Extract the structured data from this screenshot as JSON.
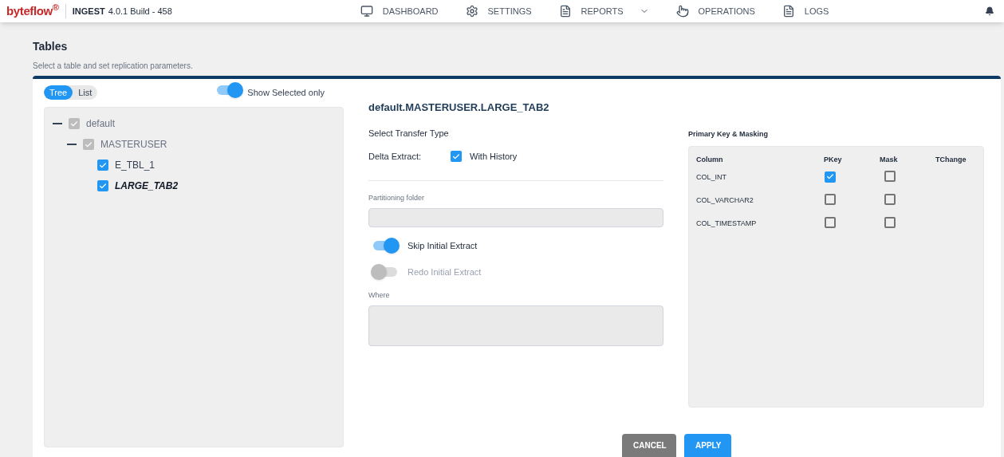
{
  "header": {
    "logo": "byteflow$^{®}$",
    "product": "INGEST",
    "version": "4.0.1 Build - 458",
    "nav": [
      {
        "label": "DASHBOARD",
        "dropdown": false
      },
      {
        "label": "SETTINGS",
        "dropdown": false
      },
      {
        "label": "REPORTS",
        "dropdown": true
      },
      {
        "label": "OPERATIONS",
        "dropdown": false
      },
      {
        "label": "LOGS",
        "dropdown": false
      }
    ]
  },
  "page": {
    "title": "Tables",
    "subtitle": "Select a table and set replication parameters."
  },
  "view_tabs": [
    {
      "label": "Tree",
      "selected": true
    },
    {
      "label": "List",
      "selected": false
    }
  ],
  "show_selected": {
    "label": "Show Selected only",
    "on": true
  },
  "tree": [
    {
      "label": "default",
      "checked": true,
      "disabled": true,
      "expanded": true,
      "selected": false,
      "children": [
        {
          "label": "MASTERUSER",
          "checked": true,
          "disabled": true,
          "expanded": true,
          "selected": false,
          "children": [
            {
              "label": "E_TBL_1",
              "checked": true,
              "disabled": false,
              "selected": false
            },
            {
              "label": "LARGE_TAB2",
              "checked": true,
              "disabled": false,
              "selected": true
            }
          ]
        }
      ]
    }
  ],
  "detail": {
    "title": "default.MASTERUSER.LARGE_TAB2",
    "transfer_type_label": "Select Transfer Type",
    "delta_label": "Delta Extract:",
    "with_history": {
      "label": "With History",
      "checked": true
    },
    "partition_folder": {
      "label": "Partitioning folder"
    },
    "switches": [
      {
        "label": "Skip Initial Extract",
        "on": true,
        "disabled": false
      },
      {
        "label": "Redo Initial Extract",
        "on": false,
        "disabled": true
      }
    ],
    "where": {
      "label": "Where"
    }
  },
  "pk_masking": {
    "title": "Primary Key & Masking",
    "columns": [
      "Column",
      "PKey",
      "Mask",
      "TChange"
    ],
    "rows": [
      {
        "name": "COL_INT",
        "pkey": true,
        "mask": false
      },
      {
        "name": "COL_VARCHAR2",
        "pkey": false,
        "mask": false
      },
      {
        "name": "COL_TIMESTAMP",
        "pkey": false,
        "mask": false
      }
    ]
  },
  "buttons": [
    {
      "label": "CANCEL",
      "kind": "secondary"
    },
    {
      "label": "APPLY",
      "kind": "primary"
    }
  ]
}
